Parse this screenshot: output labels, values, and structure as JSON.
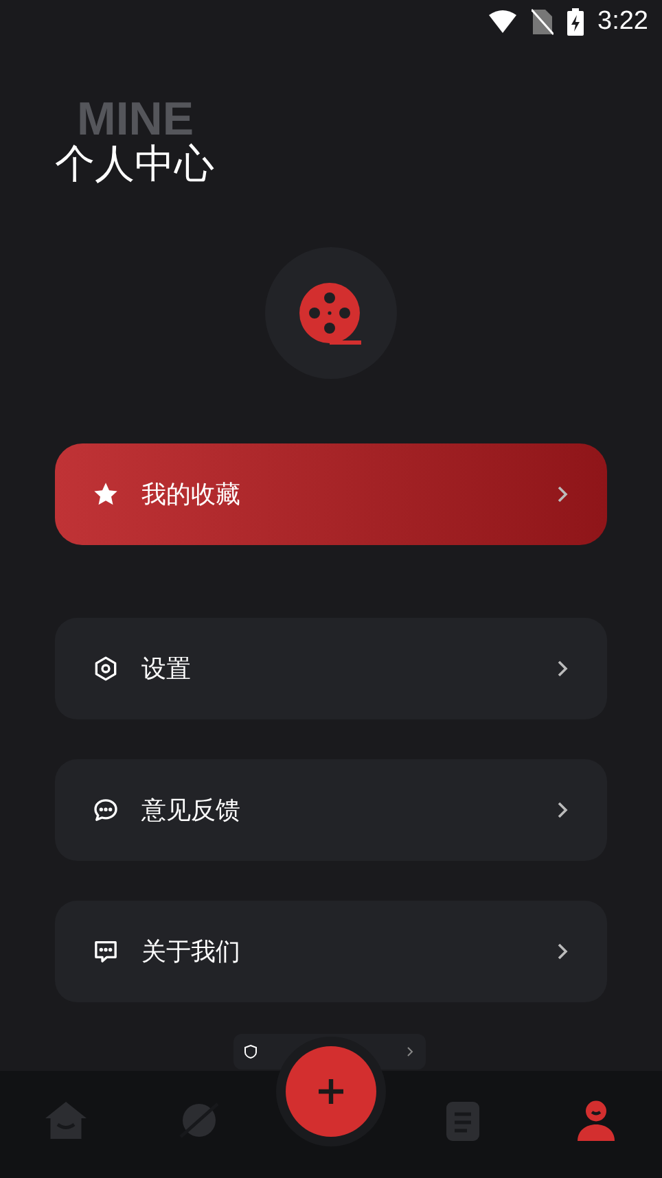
{
  "status_bar": {
    "time": "3:22"
  },
  "header": {
    "backdrop": "MINE",
    "title": "个人中心"
  },
  "menu": [
    {
      "label": "我的收藏",
      "selected": true
    },
    {
      "label": "设置",
      "selected": false
    },
    {
      "label": "意见反馈",
      "selected": false
    },
    {
      "label": "关于我们",
      "selected": false
    }
  ],
  "bottom_nav": [
    {
      "selected": false
    },
    {
      "selected": false
    },
    {
      "selected": false
    },
    {
      "selected": false
    },
    {
      "selected": true
    }
  ]
}
